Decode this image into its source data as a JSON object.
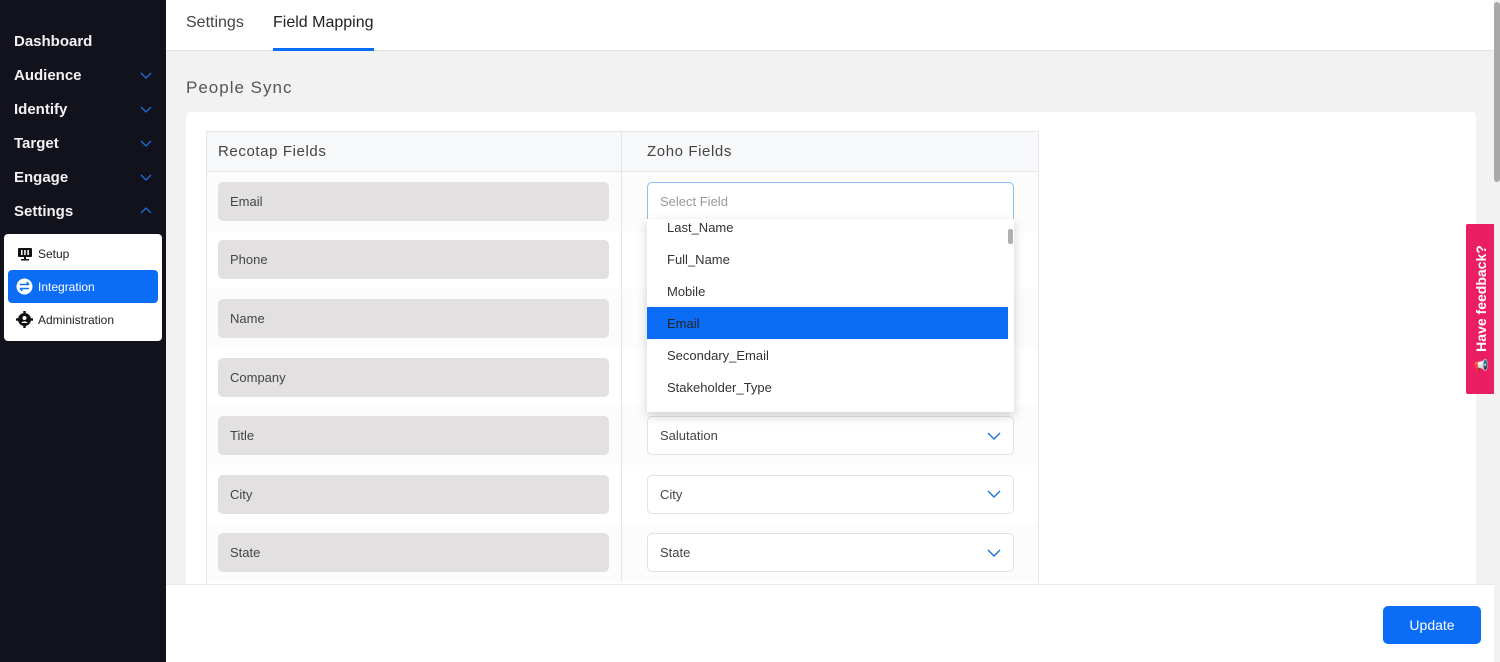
{
  "sidebar": {
    "items": [
      {
        "label": "Dashboard",
        "has_chevron": false
      },
      {
        "label": "Audience",
        "has_chevron": true,
        "expanded": false
      },
      {
        "label": "Identify",
        "has_chevron": true,
        "expanded": false
      },
      {
        "label": "Target",
        "has_chevron": true,
        "expanded": false
      },
      {
        "label": "Engage",
        "has_chevron": true,
        "expanded": false
      },
      {
        "label": "Settings",
        "has_chevron": true,
        "expanded": true
      }
    ],
    "submenu": [
      {
        "label": "Setup",
        "icon": "monitor-icon",
        "active": false
      },
      {
        "label": "Integration",
        "icon": "integration-icon",
        "active": true
      },
      {
        "label": "Administration",
        "icon": "gear-user-icon",
        "active": false
      }
    ]
  },
  "tabs": [
    {
      "label": "Settings",
      "active": false
    },
    {
      "label": "Field Mapping",
      "active": true
    }
  ],
  "section_title": "People Sync",
  "table": {
    "headers": [
      "Recotap Fields",
      "Zoho Fields"
    ],
    "rows": [
      {
        "recotap": "Email",
        "zoho": "",
        "zoho_placeholder": "Select Field",
        "open": true
      },
      {
        "recotap": "Phone",
        "zoho": ""
      },
      {
        "recotap": "Name",
        "zoho": ""
      },
      {
        "recotap": "Company",
        "zoho": ""
      },
      {
        "recotap": "Title",
        "zoho": "Salutation"
      },
      {
        "recotap": "City",
        "zoho": "City"
      },
      {
        "recotap": "State",
        "zoho": "State"
      }
    ]
  },
  "dropdown": {
    "options": [
      "Last_Name",
      "Full_Name",
      "Mobile",
      "Email",
      "Secondary_Email",
      "Stakeholder_Type"
    ],
    "highlighted": "Email"
  },
  "footer": {
    "update_label": "Update"
  },
  "feedback": {
    "label": "Have feedback?"
  },
  "colors": {
    "accent": "#0b6cf5",
    "sidebar_bg": "#12121c",
    "feedback": "#e91e63"
  }
}
